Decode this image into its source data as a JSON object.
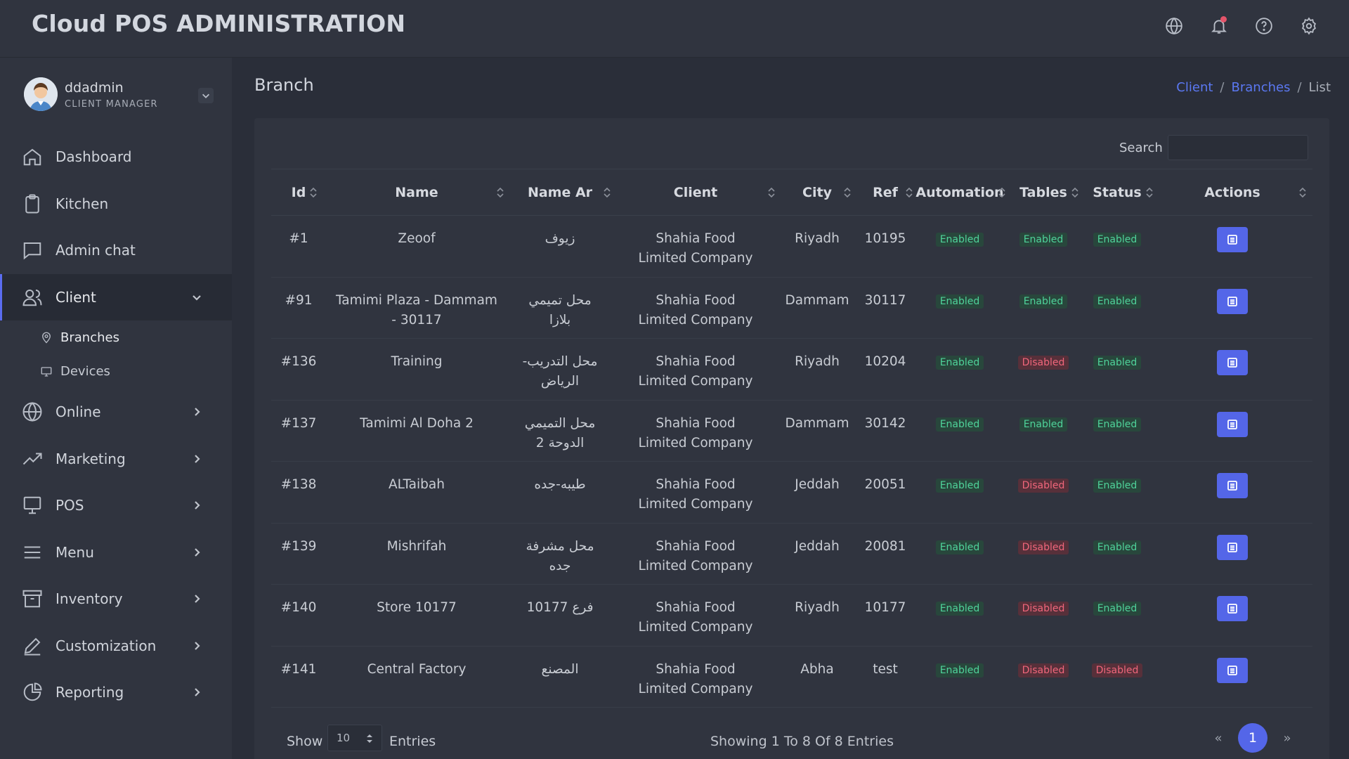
{
  "app_title": "Cloud POS ADMINISTRATION",
  "topbar_icons": [
    "globe-icon",
    "bell-icon",
    "help-icon",
    "gear-icon"
  ],
  "user": {
    "name": "ddadmin",
    "role": "CLIENT MANAGER"
  },
  "nav": {
    "dashboard": "Dashboard",
    "kitchen": "Kitchen",
    "admin_chat": "Admin chat",
    "client": "Client",
    "branches": "Branches",
    "devices": "Devices",
    "online": "Online",
    "marketing": "Marketing",
    "pos": "POS",
    "menu": "Menu",
    "inventory": "Inventory",
    "customization": "Customization",
    "reporting": "Reporting"
  },
  "page_title": "Branch",
  "breadcrumb": {
    "client": "Client",
    "branches": "Branches",
    "current": "List",
    "sep": "/"
  },
  "search": {
    "label": "Search",
    "value": ""
  },
  "table": {
    "columns": [
      "Id",
      "Name",
      "Name Ar",
      "Client",
      "City",
      "Ref",
      "Automation",
      "Tables",
      "Status",
      "Actions"
    ],
    "rows": [
      {
        "id": "#1",
        "name": "Zeoof",
        "name_ar": "زيوف",
        "client": "Shahia Food Limited Company",
        "city": "Riyadh",
        "ref": "10195",
        "automation": "Enabled",
        "tables": "Enabled",
        "status": "Enabled"
      },
      {
        "id": "#91",
        "name": "Tamimi Plaza - Dammam - 30117",
        "name_ar": "محل تميمي بلازا",
        "client": "Shahia Food Limited Company",
        "city": "Dammam",
        "ref": "30117",
        "automation": "Enabled",
        "tables": "Enabled",
        "status": "Enabled"
      },
      {
        "id": "#136",
        "name": "Training",
        "name_ar": "محل التدريب- الرياض",
        "client": "Shahia Food Limited Company",
        "city": "Riyadh",
        "ref": "10204",
        "automation": "Enabled",
        "tables": "Disabled",
        "status": "Enabled"
      },
      {
        "id": "#137",
        "name": "Tamimi Al Doha 2",
        "name_ar": "محل التميمي الدوحة 2",
        "client": "Shahia Food Limited Company",
        "city": "Dammam",
        "ref": "30142",
        "automation": "Enabled",
        "tables": "Enabled",
        "status": "Enabled"
      },
      {
        "id": "#138",
        "name": "ALTaibah",
        "name_ar": "طيبه-جده",
        "client": "Shahia Food Limited Company",
        "city": "Jeddah",
        "ref": "20051",
        "automation": "Enabled",
        "tables": "Disabled",
        "status": "Enabled"
      },
      {
        "id": "#139",
        "name": "Mishrifah",
        "name_ar": "محل مشرفة جده",
        "client": "Shahia Food Limited Company",
        "city": "Jeddah",
        "ref": "20081",
        "automation": "Enabled",
        "tables": "Disabled",
        "status": "Enabled"
      },
      {
        "id": "#140",
        "name": "Store 10177",
        "name_ar": "فرع 10177",
        "client": "Shahia Food Limited Company",
        "city": "Riyadh",
        "ref": "10177",
        "automation": "Enabled",
        "tables": "Disabled",
        "status": "Enabled"
      },
      {
        "id": "#141",
        "name": "Central Factory",
        "name_ar": "المصنع",
        "client": "Shahia Food Limited Company",
        "city": "Abha",
        "ref": "test",
        "automation": "Enabled",
        "tables": "Disabled",
        "status": "Disabled"
      }
    ]
  },
  "footer": {
    "show": "Show",
    "page_size": "10",
    "entries": "Entries",
    "info": "Showing 1 To 8 Of 8 Entries",
    "prev": "«",
    "page": "1",
    "next": "»"
  },
  "colors": {
    "accent": "#5466e8",
    "enabled": "#4fd39a",
    "disabled": "#f0667b",
    "link": "#5b78f2"
  }
}
